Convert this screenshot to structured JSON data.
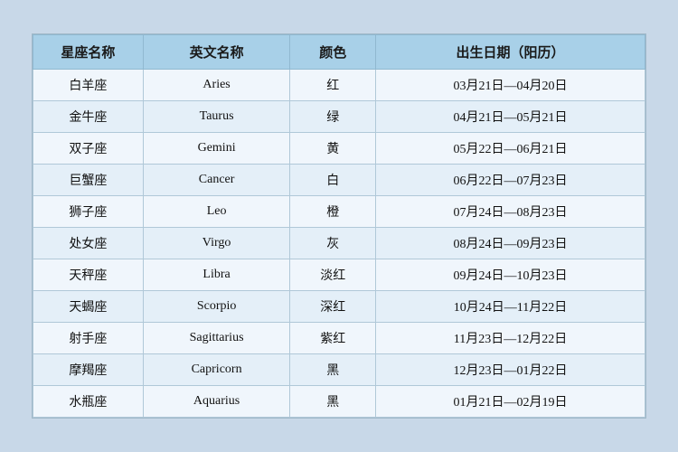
{
  "table": {
    "headers": {
      "zh_name": "星座名称",
      "en_name": "英文名称",
      "color": "颜色",
      "date": "出生日期（阳历）"
    },
    "rows": [
      {
        "zh": "白羊座",
        "en": "Aries",
        "color": "红",
        "date": "03月21日—04月20日"
      },
      {
        "zh": "金牛座",
        "en": "Taurus",
        "color": "绿",
        "date": "04月21日—05月21日"
      },
      {
        "zh": "双子座",
        "en": "Gemini",
        "color": "黄",
        "date": "05月22日—06月21日"
      },
      {
        "zh": "巨蟹座",
        "en": "Cancer",
        "color": "白",
        "date": "06月22日—07月23日"
      },
      {
        "zh": "狮子座",
        "en": "Leo",
        "color": "橙",
        "date": "07月24日—08月23日"
      },
      {
        "zh": "处女座",
        "en": "Virgo",
        "color": "灰",
        "date": "08月24日—09月23日"
      },
      {
        "zh": "天秤座",
        "en": "Libra",
        "color": "淡红",
        "date": "09月24日—10月23日"
      },
      {
        "zh": "天蝎座",
        "en": "Scorpio",
        "color": "深红",
        "date": "10月24日—11月22日"
      },
      {
        "zh": "射手座",
        "en": "Sagittarius",
        "color": "紫红",
        "date": "11月23日—12月22日"
      },
      {
        "zh": "摩羯座",
        "en": "Capricorn",
        "color": "黑",
        "date": "12月23日—01月22日"
      },
      {
        "zh": "水瓶座",
        "en": "Aquarius",
        "color": "黑",
        "date": "01月21日—02月19日"
      }
    ]
  }
}
